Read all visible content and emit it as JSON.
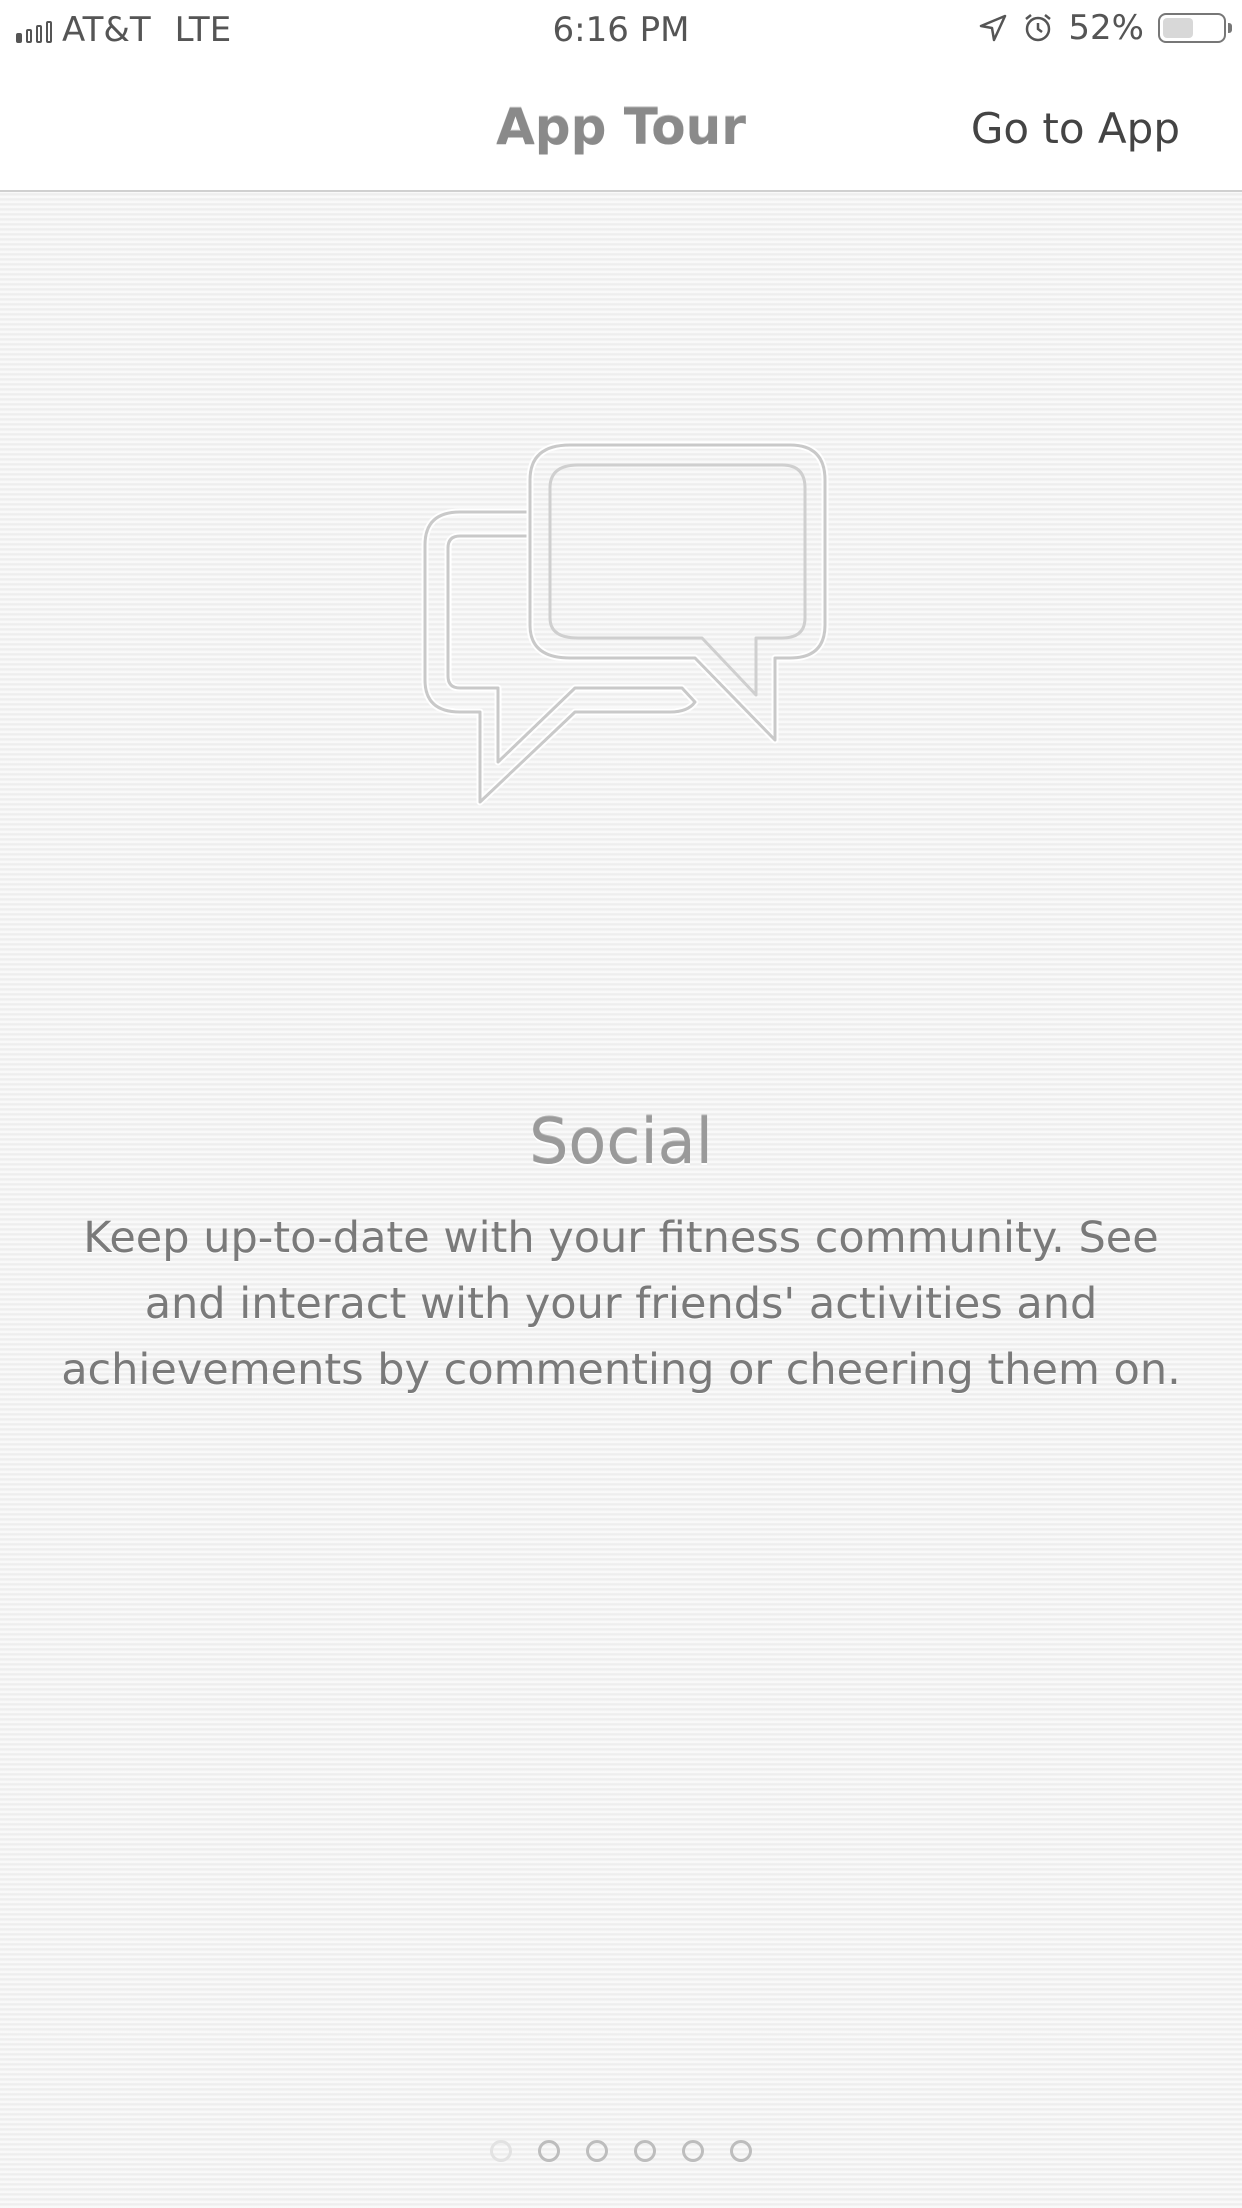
{
  "status_bar": {
    "carrier": "AT&T",
    "network": "LTE",
    "time": "6:16 PM",
    "battery_percent": "52%",
    "battery_level": 0.52
  },
  "nav": {
    "title": "App Tour",
    "action_label": "Go to App"
  },
  "slide": {
    "icon": "chat-bubbles-icon",
    "title": "Social",
    "description": "Keep up-to-date with your fitness community. See and interact with your friends' activities and achievements by commenting or cheering them on."
  },
  "pager": {
    "total_pages": 6,
    "current_page": 1
  },
  "colors": {
    "background": "#f1f1f1",
    "title_text": "#9a9a9a",
    "body_text": "#7a7a7a"
  }
}
